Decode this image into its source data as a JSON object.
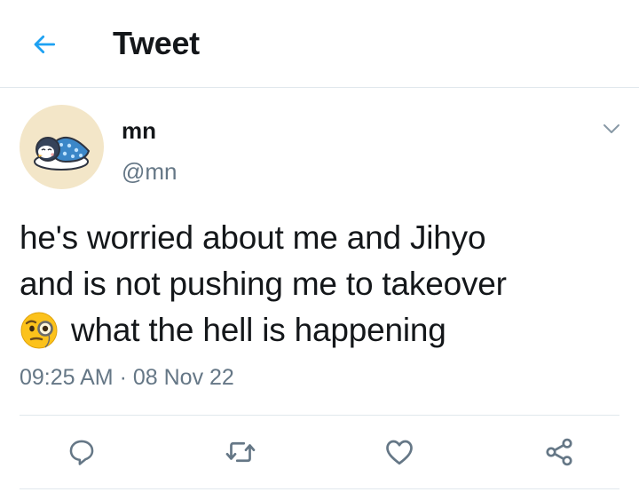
{
  "header": {
    "title": "Tweet",
    "back_icon": "arrow-left-icon",
    "accent_color": "#1da1f2"
  },
  "tweet": {
    "author": {
      "display_name": "mn",
      "handle": "@mn",
      "avatar": "penguin-sleeping-avatar"
    },
    "text_lines": [
      "he's worried about me and Jihyo",
      "and is not pushing me to takeover",
      "what the hell is happening"
    ],
    "inline_emoji": "face-with-monocle",
    "time": "09:25 AM",
    "separator": "·",
    "date": "08 Nov 22"
  },
  "actions": [
    {
      "icon": "reply-icon"
    },
    {
      "icon": "retweet-icon"
    },
    {
      "icon": "like-icon"
    },
    {
      "icon": "share-icon"
    }
  ],
  "colors": {
    "text": "#14171a",
    "secondary": "#657786",
    "border": "#e1e8ed"
  }
}
